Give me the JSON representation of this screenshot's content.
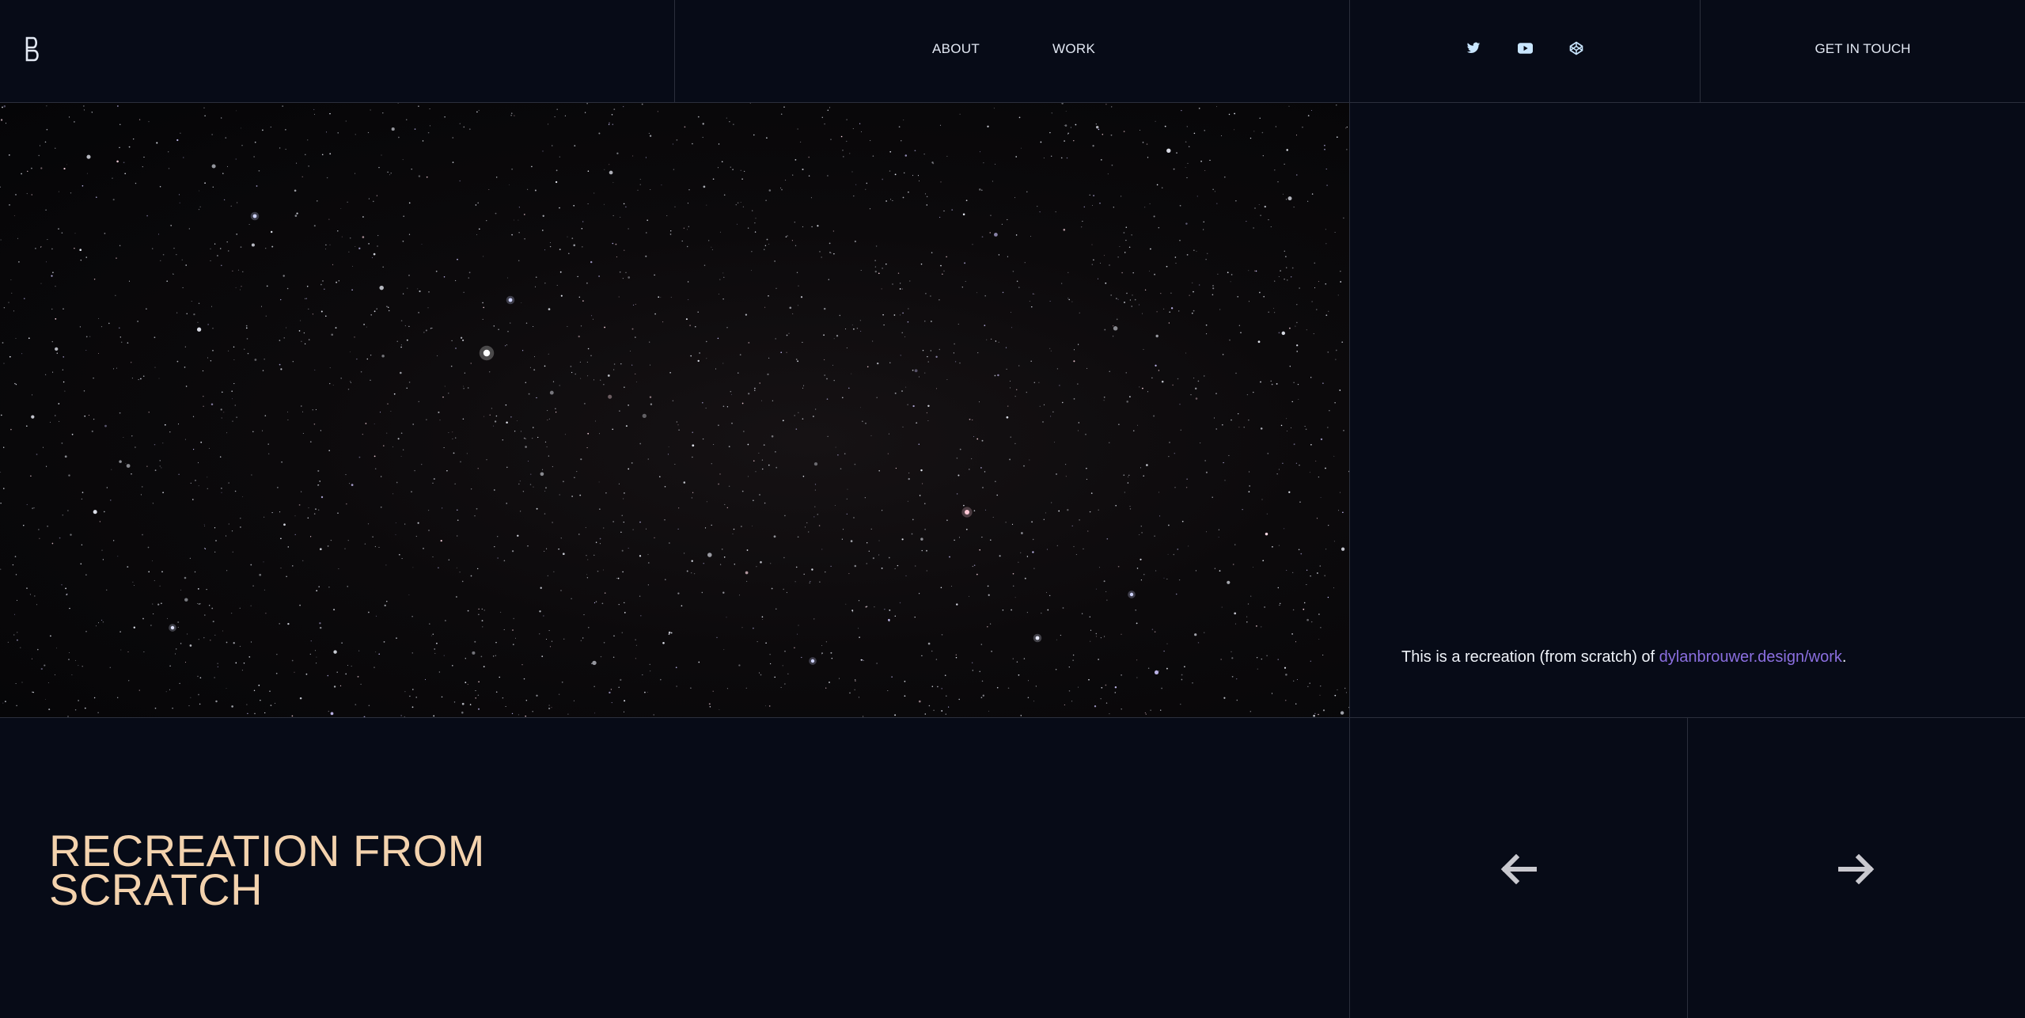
{
  "header": {
    "logo_icon": "db-monogram-logo",
    "nav": [
      {
        "label": "ABOUT"
      },
      {
        "label": "WORK"
      }
    ],
    "social_icons": [
      "twitter-icon",
      "youtube-icon",
      "codepen-icon"
    ],
    "cta_label": "GET IN TOUCH"
  },
  "hero": {
    "image_subject": "starfield-night-sky"
  },
  "credit": {
    "prefix": "This is a recreation (from scratch) of ",
    "link_text": "dylanbrouwer.design/work",
    "suffix": "."
  },
  "project": {
    "title_line1": "RECREATION FROM",
    "title_line2": "SCRATCH"
  },
  "navigation": {
    "prev_icon": "arrow-left-icon",
    "next_icon": "arrow-right-icon"
  },
  "colors": {
    "background": "#070b17",
    "title": "#f3d2ad",
    "link": "#8b6fe0",
    "grid_line": "#2b2f3c"
  }
}
